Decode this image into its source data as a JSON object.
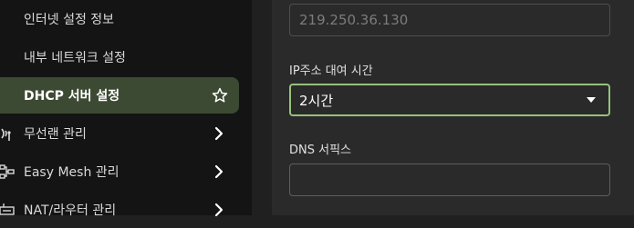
{
  "sidebar": {
    "items": [
      {
        "label": "인터넷 설정 정보"
      },
      {
        "label": "내부 네트워크 설정"
      },
      {
        "label": "DHCP 서버 설정",
        "icon": "star-icon",
        "active": true
      },
      {
        "label": "무선랜 관리",
        "icon": "wireless-icon",
        "arrow": "chevron-right-icon"
      },
      {
        "label": "Easy Mesh 관리",
        "icon": "mesh-icon",
        "arrow": "chevron-right-icon"
      },
      {
        "label": "NAT/라우터 관리",
        "icon": "router-icon",
        "arrow": "chevron-right-icon"
      }
    ]
  },
  "form": {
    "ip_field": {
      "value": "219.250.36.130"
    },
    "lease": {
      "label": "IP주소 대여 시간",
      "value": "2시간"
    },
    "dns": {
      "label": "DNS 서픽스",
      "value": ""
    }
  },
  "colors": {
    "accent": "#97c27a",
    "active_bg": "#3d4a33"
  }
}
